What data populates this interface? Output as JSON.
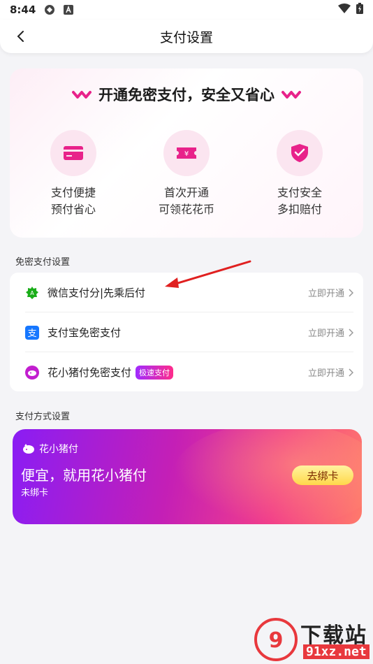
{
  "status_bar": {
    "time": "8:44"
  },
  "nav": {
    "title": "支付设置"
  },
  "promo": {
    "title": "开通免密支付，安全又省心",
    "features": [
      {
        "line1": "支付便捷",
        "line2": "预付省心",
        "icon": "card-icon"
      },
      {
        "line1": "首次开通",
        "line2": "可领花花币",
        "icon": "coupon-icon"
      },
      {
        "line1": "支付安全",
        "line2": "多扣赔付",
        "icon": "shield-check-icon"
      }
    ]
  },
  "password_free_section": {
    "label": "免密支付设置",
    "rows": [
      {
        "label": "微信支付分|先乘后付",
        "action": "立即开通",
        "icon": "wechat-pay-score-icon",
        "color": "#1aad19"
      },
      {
        "label": "支付宝免密支付",
        "action": "立即开通",
        "icon": "alipay-icon",
        "color": "#1677ff"
      },
      {
        "label": "花小猪付免密支付",
        "action": "立即开通",
        "icon": "huaxiaozhu-pay-icon",
        "color": "#c21ecf",
        "badge": "极速支付"
      }
    ]
  },
  "payment_method_section": {
    "label": "支付方式设置",
    "card": {
      "brand": "花小猪付",
      "headline": "便宜，就用花小猪付",
      "status": "未绑卡",
      "button": "去绑卡"
    }
  },
  "watermark": {
    "text": "下载站",
    "url": "91xz.net"
  },
  "colors": {
    "accent_pink": "#e8228a",
    "accent_purple": "#8a1df4",
    "background": "#f4f4f7"
  }
}
